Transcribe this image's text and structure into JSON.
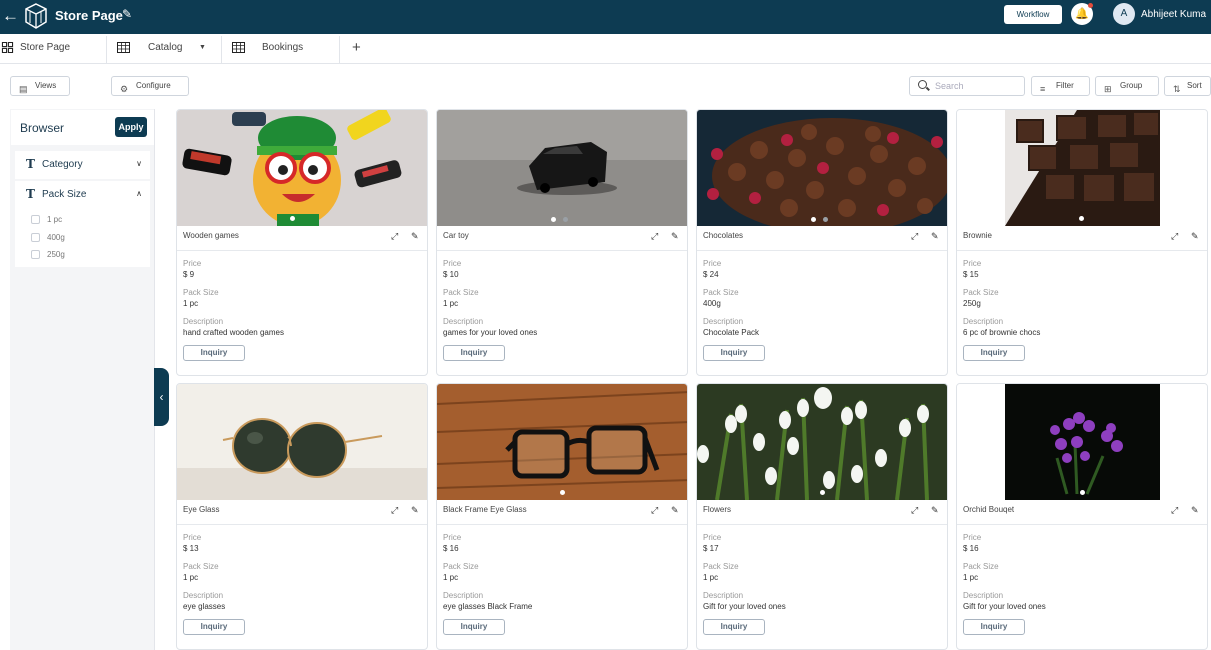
{
  "topbar": {
    "title": "Store Page",
    "workflow_label": "Workflow",
    "avatar_initial": "A",
    "user_name": "Abhijeet Kuma"
  },
  "tabs": [
    {
      "label": "Store Page",
      "icon": "grid-icon"
    },
    {
      "label": "Catalog",
      "icon": "table-icon"
    },
    {
      "label": "Bookings",
      "icon": "table-icon"
    }
  ],
  "toolbar": {
    "views_label": "Views",
    "configure_label": "Configure",
    "search_placeholder": "Search",
    "filter_label": "Filter",
    "group_label": "Group",
    "sort_label": "Sort"
  },
  "sidebar": {
    "title": "Browser",
    "apply_label": "Apply",
    "facet_type_glyph": "T",
    "facets": [
      {
        "label": "Category",
        "expanded": false
      },
      {
        "label": "Pack Size",
        "expanded": true,
        "options": [
          "1 pc",
          "400g",
          "250g"
        ]
      }
    ]
  },
  "card_labels": {
    "price": "Price",
    "pack_size": "Pack Size",
    "description": "Description",
    "inquiry": "Inquiry"
  },
  "products": [
    {
      "name": "Wooden games",
      "price": "$ 9",
      "pack": "1 pc",
      "description": "hand crafted wooden games"
    },
    {
      "name": "Car toy",
      "price": "$ 10",
      "pack": "1 pc",
      "description": "games for your loved ones"
    },
    {
      "name": "Chocolates",
      "price": "$ 24",
      "pack": "400g",
      "description": "Chocolate Pack"
    },
    {
      "name": "Brownie",
      "price": "$ 15",
      "pack": "250g",
      "description": "6 pc of brownie chocs"
    },
    {
      "name": "Eye Glass",
      "price": "$ 13",
      "pack": "1 pc",
      "description": "eye glasses"
    },
    {
      "name": "Black Frame Eye Glass",
      "price": "$ 16",
      "pack": "1 pc",
      "description": "eye glasses Black Frame"
    },
    {
      "name": "Flowers",
      "price": "$ 17",
      "pack": "1 pc",
      "description": "Gift for your loved ones"
    },
    {
      "name": "Orchid Bouqet",
      "price": "$ 16",
      "pack": "1 pc",
      "description": "Gift for your loved ones"
    }
  ]
}
